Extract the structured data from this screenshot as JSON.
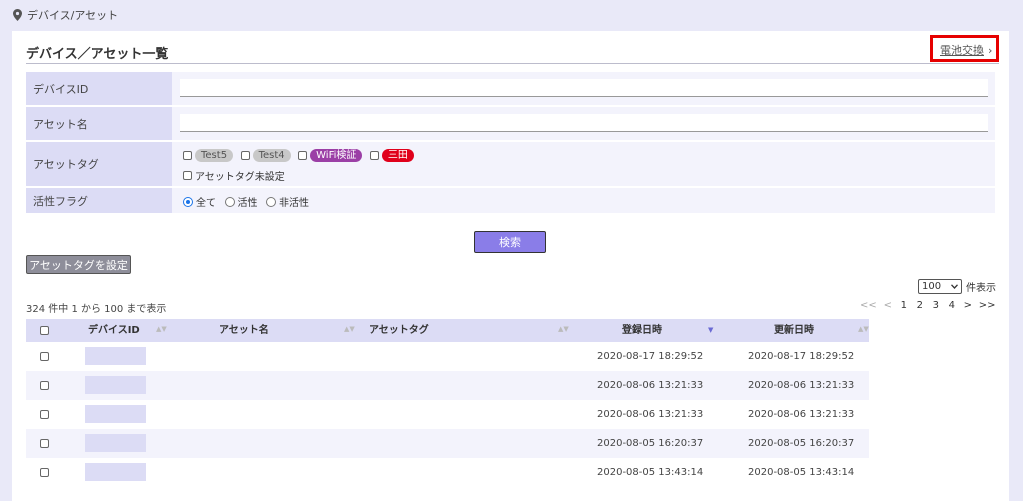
{
  "breadcrumb": {
    "icon": "map-pin-icon",
    "text": "デバイス/アセット"
  },
  "page": {
    "title": "デバイス／アセット一覧",
    "battery_link": "電池交換",
    "battery_chevron": "›"
  },
  "filters": {
    "device_id_label": "デバイスID",
    "asset_name_label": "アセット名",
    "asset_tag_label": "アセットタグ",
    "tags": [
      {
        "label": "Test5",
        "bg": "#c8c8c8",
        "fg": "#555555"
      },
      {
        "label": "Test4",
        "bg": "#c8c8c8",
        "fg": "#555555"
      },
      {
        "label": "WiFi検証",
        "bg": "#9b3fa6",
        "fg": "#ffffff"
      },
      {
        "label": "三田",
        "bg": "#e0001b",
        "fg": "#ffffff"
      }
    ],
    "untagged_label": "アセットタグ未設定",
    "active_flag_label": "活性フラグ",
    "active_options": [
      {
        "label": "全て",
        "selected": true
      },
      {
        "label": "活性",
        "selected": false
      },
      {
        "label": "非活性",
        "selected": false
      }
    ]
  },
  "actions": {
    "search": "検索",
    "set_asset_tag": "アセットタグを設定"
  },
  "per_page": {
    "value": "100",
    "suffix": "件表示"
  },
  "summary": "324 件中 1 から 100 まで表示",
  "pagination": [
    "<<",
    "<",
    "1",
    "2",
    "3",
    "4",
    ">",
    ">>"
  ],
  "table": {
    "headers": {
      "device_id": "デバイスID",
      "asset_name": "アセット名",
      "asset_tag": "アセットタグ",
      "registered": "登録日時",
      "updated": "更新日時"
    },
    "rows": [
      {
        "registered": "2020-08-17 18:29:52",
        "updated": "2020-08-17 18:29:52"
      },
      {
        "registered": "2020-08-06 13:21:33",
        "updated": "2020-08-06 13:21:33"
      },
      {
        "registered": "2020-08-06 13:21:33",
        "updated": "2020-08-06 13:21:33"
      },
      {
        "registered": "2020-08-05 16:20:37",
        "updated": "2020-08-05 16:20:37"
      },
      {
        "registered": "2020-08-05 13:43:14",
        "updated": "2020-08-05 13:43:14"
      }
    ]
  },
  "colors": {
    "accent": "#8a7de8",
    "highlight_border": "#e60000",
    "label_bg": "#dcdcf5"
  }
}
